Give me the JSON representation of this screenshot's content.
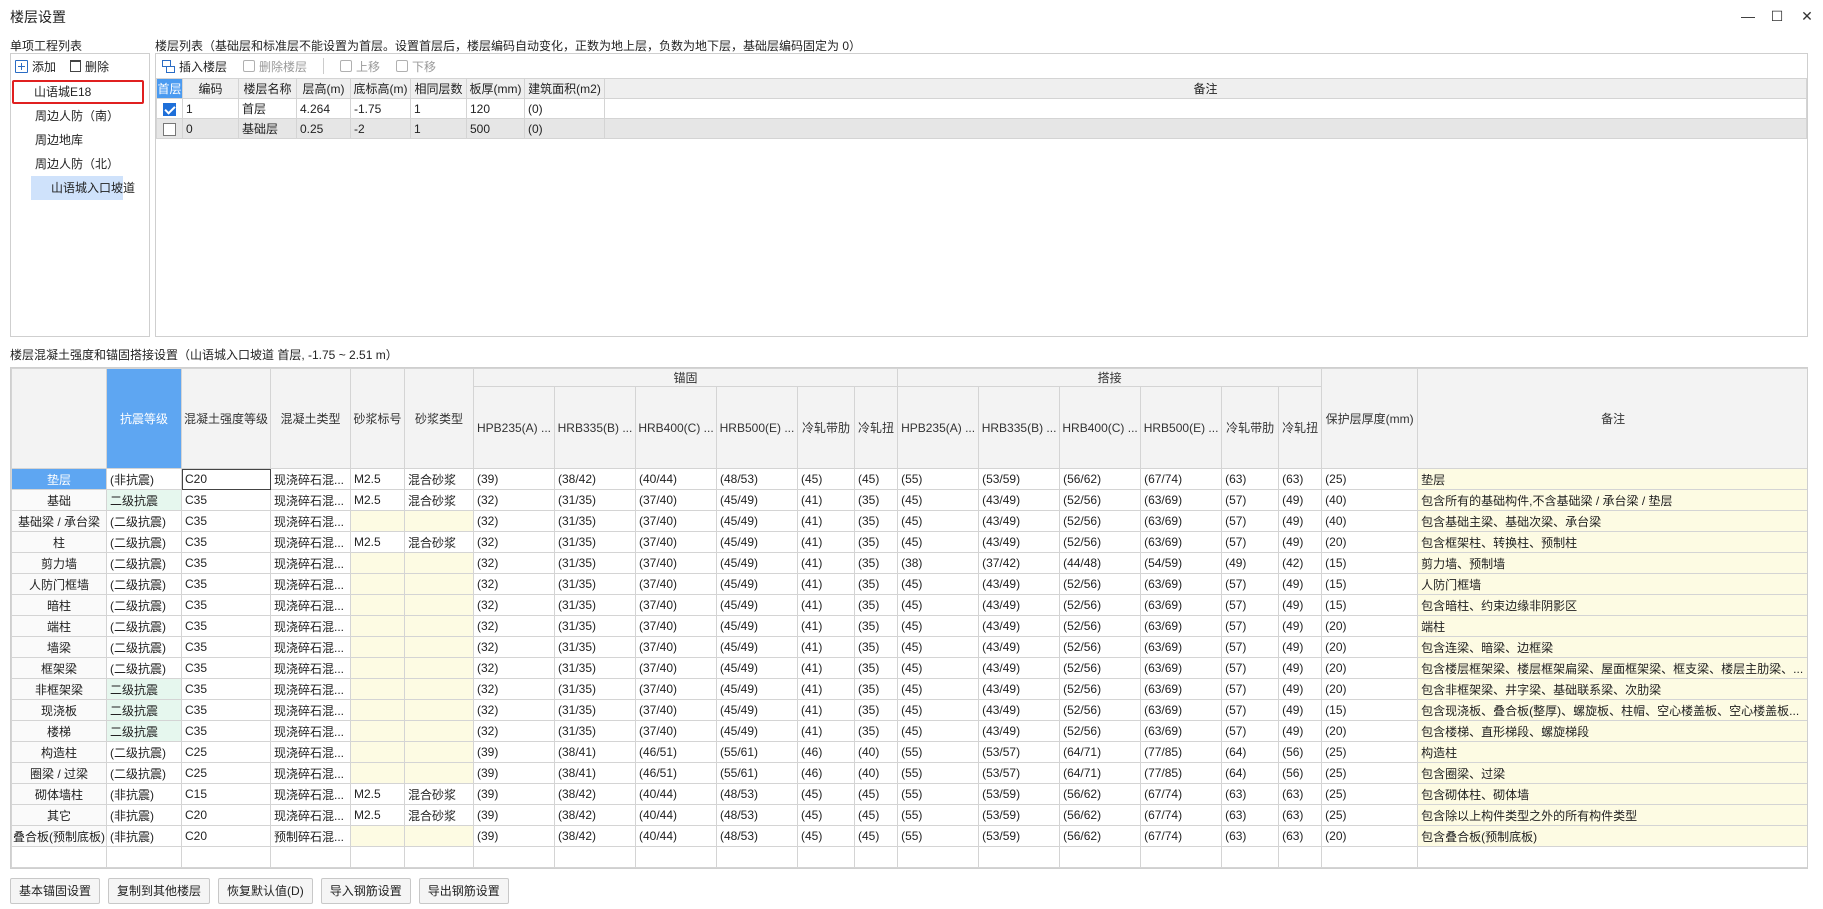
{
  "window": {
    "title": "楼层设置",
    "minimize": "—",
    "maximize": "☐",
    "close": "✕"
  },
  "project_panel": {
    "label": "单项工程列表",
    "add": "添加",
    "delete": "删除",
    "items": [
      "山语城E18",
      "周边人防（南）",
      "周边地库",
      "周边人防（北）",
      "山语城入口坡道"
    ]
  },
  "floor_panel": {
    "label": "楼层列表（基础层和标准层不能设置为首层。设置首层后，楼层编码自动变化，正数为地上层，负数为地下层，基础层编码固定为 0）",
    "toolbar": {
      "insert": "插入楼层",
      "delete": "删除楼层",
      "up": "上移",
      "down": "下移"
    },
    "headers": [
      "首层",
      "编码",
      "楼层名称",
      "层高(m)",
      "底标高(m)",
      "相同层数",
      "板厚(mm)",
      "建筑面积(m2)",
      "备注"
    ],
    "rows": [
      {
        "first": true,
        "code": "1",
        "name": "首层",
        "height": "4.264",
        "bottom": "-1.75",
        "same": "1",
        "slab": "120",
        "area": "(0)",
        "note": ""
      },
      {
        "first": false,
        "code": "0",
        "name": "基础层",
        "height": "0.25",
        "bottom": "-2",
        "same": "1",
        "slab": "500",
        "area": "(0)",
        "note": ""
      }
    ]
  },
  "settings": {
    "label": "楼层混凝土强度和锚固搭接设置（山语城入口坡道 首层, -1.75 ~ 2.51 m）",
    "group_anchor": "锚固",
    "group_lap": "搭接",
    "headers": {
      "seismic": "抗震等级",
      "strength": "混凝土强度等级",
      "ctype": "混凝土类型",
      "mortar_grade": "砂浆标号",
      "mortar_type": "砂浆类型",
      "hpb235": "HPB235(A) ...",
      "hrb335": "HRB335(B) ...",
      "hrb400": "HRB400(C) ...",
      "hrb500": "HRB500(E) ...",
      "cold_ribbed": "冷轧带肋",
      "cold_twisted": "冷轧扭",
      "cover": "保护层厚度(mm)",
      "note": "备注"
    },
    "rows": [
      {
        "name": "垫层",
        "seismic": "(非抗震)",
        "strength": "C20",
        "ctype": "现浇碎石混...",
        "mg": "M2.5",
        "mt": "混合砂浆",
        "a": [
          "(39)",
          "(38/42)",
          "(40/44)",
          "(48/53)",
          "(45)",
          "(45)"
        ],
        "l": [
          "(55)",
          "(53/59)",
          "(56/62)",
          "(67/74)",
          "(63)",
          "(63)"
        ],
        "cover": "(25)",
        "note": "垫层"
      },
      {
        "name": "基础",
        "seismic": "二级抗震",
        "strength": "C35",
        "ctype": "现浇碎石混...",
        "mg": "M2.5",
        "mt": "混合砂浆",
        "a": [
          "(32)",
          "(31/35)",
          "(37/40)",
          "(45/49)",
          "(41)",
          "(35)"
        ],
        "l": [
          "(45)",
          "(43/49)",
          "(52/56)",
          "(63/69)",
          "(57)",
          "(49)"
        ],
        "cover": "(40)",
        "note": "包含所有的基础构件,不含基础梁 / 承台梁 / 垫层"
      },
      {
        "name": "基础梁 / 承台梁",
        "seismic": "(二级抗震)",
        "strength": "C35",
        "ctype": "现浇碎石混...",
        "mg": "",
        "mt": "",
        "a": [
          "(32)",
          "(31/35)",
          "(37/40)",
          "(45/49)",
          "(41)",
          "(35)"
        ],
        "l": [
          "(45)",
          "(43/49)",
          "(52/56)",
          "(63/69)",
          "(57)",
          "(49)"
        ],
        "cover": "(40)",
        "note": "包含基础主梁、基础次梁、承台梁"
      },
      {
        "name": "柱",
        "seismic": "(二级抗震)",
        "strength": "C35",
        "ctype": "现浇碎石混...",
        "mg": "M2.5",
        "mt": "混合砂浆",
        "a": [
          "(32)",
          "(31/35)",
          "(37/40)",
          "(45/49)",
          "(41)",
          "(35)"
        ],
        "l": [
          "(45)",
          "(43/49)",
          "(52/56)",
          "(63/69)",
          "(57)",
          "(49)"
        ],
        "cover": "(20)",
        "note": "包含框架柱、转换柱、预制柱"
      },
      {
        "name": "剪力墙",
        "seismic": "(二级抗震)",
        "strength": "C35",
        "ctype": "现浇碎石混...",
        "mg": "",
        "mt": "",
        "a": [
          "(32)",
          "(31/35)",
          "(37/40)",
          "(45/49)",
          "(41)",
          "(35)"
        ],
        "l": [
          "(38)",
          "(37/42)",
          "(44/48)",
          "(54/59)",
          "(49)",
          "(42)"
        ],
        "cover": "(15)",
        "note": "剪力墙、预制墙"
      },
      {
        "name": "人防门框墙",
        "seismic": "(二级抗震)",
        "strength": "C35",
        "ctype": "现浇碎石混...",
        "mg": "",
        "mt": "",
        "a": [
          "(32)",
          "(31/35)",
          "(37/40)",
          "(45/49)",
          "(41)",
          "(35)"
        ],
        "l": [
          "(45)",
          "(43/49)",
          "(52/56)",
          "(63/69)",
          "(57)",
          "(49)"
        ],
        "cover": "(15)",
        "note": "人防门框墙"
      },
      {
        "name": "暗柱",
        "seismic": "(二级抗震)",
        "strength": "C35",
        "ctype": "现浇碎石混...",
        "mg": "",
        "mt": "",
        "a": [
          "(32)",
          "(31/35)",
          "(37/40)",
          "(45/49)",
          "(41)",
          "(35)"
        ],
        "l": [
          "(45)",
          "(43/49)",
          "(52/56)",
          "(63/69)",
          "(57)",
          "(49)"
        ],
        "cover": "(15)",
        "note": "包含暗柱、约束边缘非阴影区"
      },
      {
        "name": "端柱",
        "seismic": "(二级抗震)",
        "strength": "C35",
        "ctype": "现浇碎石混...",
        "mg": "",
        "mt": "",
        "a": [
          "(32)",
          "(31/35)",
          "(37/40)",
          "(45/49)",
          "(41)",
          "(35)"
        ],
        "l": [
          "(45)",
          "(43/49)",
          "(52/56)",
          "(63/69)",
          "(57)",
          "(49)"
        ],
        "cover": "(20)",
        "note": "端柱"
      },
      {
        "name": "墙梁",
        "seismic": "(二级抗震)",
        "strength": "C35",
        "ctype": "现浇碎石混...",
        "mg": "",
        "mt": "",
        "a": [
          "(32)",
          "(31/35)",
          "(37/40)",
          "(45/49)",
          "(41)",
          "(35)"
        ],
        "l": [
          "(45)",
          "(43/49)",
          "(52/56)",
          "(63/69)",
          "(57)",
          "(49)"
        ],
        "cover": "(20)",
        "note": "包含连梁、暗梁、边框梁"
      },
      {
        "name": "框架梁",
        "seismic": "(二级抗震)",
        "strength": "C35",
        "ctype": "现浇碎石混...",
        "mg": "",
        "mt": "",
        "a": [
          "(32)",
          "(31/35)",
          "(37/40)",
          "(45/49)",
          "(41)",
          "(35)"
        ],
        "l": [
          "(45)",
          "(43/49)",
          "(52/56)",
          "(63/69)",
          "(57)",
          "(49)"
        ],
        "cover": "(20)",
        "note": "包含楼层框架梁、楼层框架扁梁、屋面框架梁、框支梁、楼层主肋梁、..."
      },
      {
        "name": "非框架梁",
        "seismic": "二级抗震",
        "strength": "C35",
        "ctype": "现浇碎石混...",
        "mg": "",
        "mt": "",
        "a": [
          "(32)",
          "(31/35)",
          "(37/40)",
          "(45/49)",
          "(41)",
          "(35)"
        ],
        "l": [
          "(45)",
          "(43/49)",
          "(52/56)",
          "(63/69)",
          "(57)",
          "(49)"
        ],
        "cover": "(20)",
        "note": "包含非框架梁、井字梁、基础联系梁、次肋梁"
      },
      {
        "name": "现浇板",
        "seismic": "二级抗震",
        "strength": "C35",
        "ctype": "现浇碎石混...",
        "mg": "",
        "mt": "",
        "a": [
          "(32)",
          "(31/35)",
          "(37/40)",
          "(45/49)",
          "(41)",
          "(35)"
        ],
        "l": [
          "(45)",
          "(43/49)",
          "(52/56)",
          "(63/69)",
          "(57)",
          "(49)"
        ],
        "cover": "(15)",
        "note": "包含现浇板、叠合板(整厚)、螺旋板、柱帽、空心楼盖板、空心楼盖板..."
      },
      {
        "name": "楼梯",
        "seismic": "二级抗震",
        "strength": "C35",
        "ctype": "现浇碎石混...",
        "mg": "",
        "mt": "",
        "a": [
          "(32)",
          "(31/35)",
          "(37/40)",
          "(45/49)",
          "(41)",
          "(35)"
        ],
        "l": [
          "(45)",
          "(43/49)",
          "(52/56)",
          "(63/69)",
          "(57)",
          "(49)"
        ],
        "cover": "(20)",
        "note": "包含楼梯、直形梯段、螺旋梯段"
      },
      {
        "name": "构造柱",
        "seismic": "(二级抗震)",
        "strength": "C25",
        "ctype": "现浇碎石混...",
        "mg": "",
        "mt": "",
        "a": [
          "(39)",
          "(38/41)",
          "(46/51)",
          "(55/61)",
          "(46)",
          "(40)"
        ],
        "l": [
          "(55)",
          "(53/57)",
          "(64/71)",
          "(77/85)",
          "(64)",
          "(56)"
        ],
        "cover": "(25)",
        "note": "构造柱"
      },
      {
        "name": "圈梁 / 过梁",
        "seismic": "(二级抗震)",
        "strength": "C25",
        "ctype": "现浇碎石混...",
        "mg": "",
        "mt": "",
        "a": [
          "(39)",
          "(38/41)",
          "(46/51)",
          "(55/61)",
          "(46)",
          "(40)"
        ],
        "l": [
          "(55)",
          "(53/57)",
          "(64/71)",
          "(77/85)",
          "(64)",
          "(56)"
        ],
        "cover": "(25)",
        "note": "包含圈梁、过梁"
      },
      {
        "name": "砌体墙柱",
        "seismic": "(非抗震)",
        "strength": "C15",
        "ctype": "现浇碎石混...",
        "mg": "M2.5",
        "mt": "混合砂浆",
        "a": [
          "(39)",
          "(38/42)",
          "(40/44)",
          "(48/53)",
          "(45)",
          "(45)"
        ],
        "l": [
          "(55)",
          "(53/59)",
          "(56/62)",
          "(67/74)",
          "(63)",
          "(63)"
        ],
        "cover": "(25)",
        "note": "包含砌体柱、砌体墙"
      },
      {
        "name": "其它",
        "seismic": "(非抗震)",
        "strength": "C20",
        "ctype": "现浇碎石混...",
        "mg": "M2.5",
        "mt": "混合砂浆",
        "a": [
          "(39)",
          "(38/42)",
          "(40/44)",
          "(48/53)",
          "(45)",
          "(45)"
        ],
        "l": [
          "(55)",
          "(53/59)",
          "(56/62)",
          "(67/74)",
          "(63)",
          "(63)"
        ],
        "cover": "(25)",
        "note": "包含除以上构件类型之外的所有构件类型"
      },
      {
        "name": "叠合板(预制底板)",
        "seismic": "(非抗震)",
        "strength": "C20",
        "ctype": "预制碎石混...",
        "mg": "",
        "mt": "",
        "a": [
          "(39)",
          "(38/42)",
          "(40/44)",
          "(48/53)",
          "(45)",
          "(45)"
        ],
        "l": [
          "(55)",
          "(53/59)",
          "(56/62)",
          "(67/74)",
          "(63)",
          "(63)"
        ],
        "cover": "(20)",
        "note": "包含叠合板(预制底板)"
      }
    ]
  },
  "footer": {
    "buttons": [
      "基本锚固设置",
      "复制到其他楼层",
      "恢复默认值(D)",
      "导入钢筋设置",
      "导出钢筋设置"
    ]
  }
}
